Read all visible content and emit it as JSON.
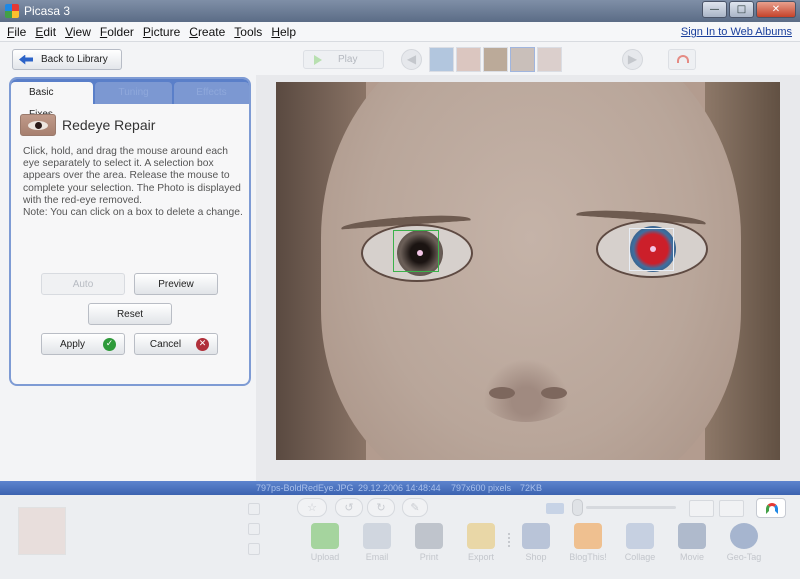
{
  "window": {
    "title": "Picasa 3",
    "controls": [
      "—",
      "□",
      "✕"
    ]
  },
  "menu": {
    "items": [
      "File",
      "Edit",
      "View",
      "Folder",
      "Picture",
      "Create",
      "Tools",
      "Help"
    ],
    "signin": "Sign In to Web Albums"
  },
  "toolbar": {
    "back_label": "Back to Library",
    "play_label": "Play"
  },
  "panel": {
    "tabs": [
      "Basic Fixes",
      "Tuning",
      "Effects"
    ],
    "tool_title": "Redeye Repair",
    "description": "Click, hold, and drag the mouse around each eye separately to select it. A selection box appears over the area.  Release the mouse to complete your selection. The Photo is displayed with the red-eye removed.\nNote: You can click on a box to delete a change.",
    "buttons": {
      "auto": "Auto",
      "preview": "Preview",
      "reset": "Reset",
      "apply": "Apply",
      "cancel": "Cancel"
    }
  },
  "info": {
    "filename": "797ps-BoldRedEye.JPG",
    "datetime": "29.12.2006 14:48:44",
    "dimensions": "797x600 pixels",
    "size": "72KB"
  },
  "share": {
    "items": [
      {
        "label": "Upload",
        "icon": "upload-icon",
        "color": "#6bbf59"
      },
      {
        "label": "Email",
        "icon": "email-icon",
        "color": "#b9c2cf"
      },
      {
        "label": "Print",
        "icon": "print-icon",
        "color": "#9aa3ad"
      },
      {
        "label": "Export",
        "icon": "export-icon",
        "color": "#e8c56a"
      },
      {
        "label": "Shop",
        "icon": "shop-icon",
        "color": "#8fa3c3"
      },
      {
        "label": "BlogThis!",
        "icon": "blogger-icon",
        "color": "#f29a3f"
      },
      {
        "label": "Collage",
        "icon": "collage-icon",
        "color": "#a7b8d3"
      },
      {
        "label": "Movie",
        "icon": "movie-icon",
        "color": "#7d8fad"
      },
      {
        "label": "Geo-Tag",
        "icon": "globe-icon",
        "color": "#6d86b3"
      }
    ]
  },
  "colors": {
    "accent": "#5a7fc9",
    "infobar": "#3c63b0",
    "selection_green": "#3bb24a"
  }
}
